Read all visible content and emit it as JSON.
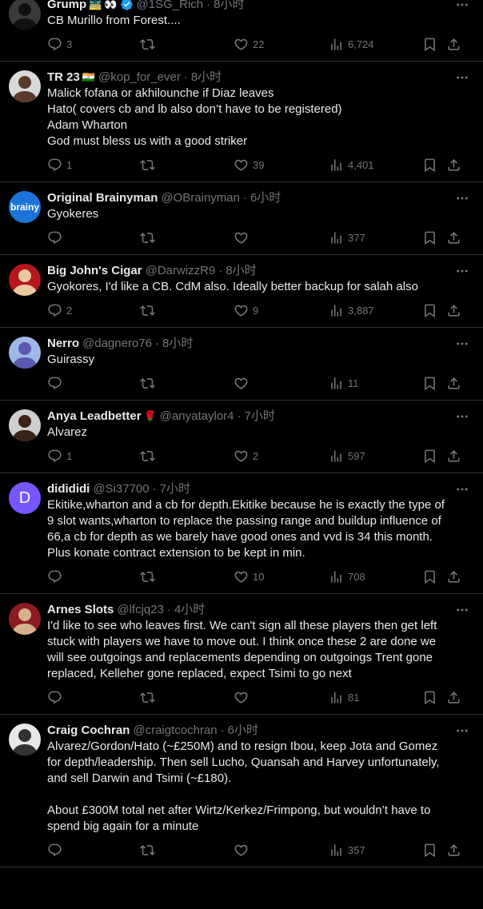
{
  "tweets": [
    {
      "name": "Grump",
      "badges": [
        "🚟",
        "👀",
        "verified"
      ],
      "handle": "@1SG_Rich",
      "time": "8小时",
      "lines": [
        "CB Murillo from Forest...."
      ],
      "replies": "3",
      "retweets": "",
      "likes": "22",
      "views": "6,724",
      "avatar": {
        "type": "photo",
        "bg": "#3a3a3a",
        "fg": "#111111"
      }
    },
    {
      "name": "TR 23",
      "badges": [
        "🇮🇳"
      ],
      "handle": "@kop_for_ever",
      "time": "8小时",
      "lines": [
        "Malick fofana or akhilounche if Diaz leaves",
        "Hato( covers cb and lb also don’t have to be registered)",
        "Adam Wharton",
        "God must bless us with a good striker"
      ],
      "replies": "1",
      "retweets": "",
      "likes": "39",
      "views": "4,401",
      "avatar": {
        "type": "photo",
        "bg": "#d9d9d9",
        "fg": "#5b3a29"
      }
    },
    {
      "name": "Original Brainyman",
      "badges": [],
      "handle": "@OBrainyman",
      "time": "6小时",
      "lines": [
        "Gyokeres"
      ],
      "replies": "",
      "retweets": "",
      "likes": "",
      "views": "377",
      "avatar": {
        "type": "logo",
        "bg": "#1d74d8",
        "text": "brainy"
      }
    },
    {
      "name": "Big John's Cigar",
      "badges": [],
      "handle": "@DarwizzR9",
      "time": "8小时",
      "lines": [
        "Gyokores, I'd like a CB. CdM also. Ideally better backup for salah also"
      ],
      "replies": "2",
      "retweets": "",
      "likes": "9",
      "views": "3,887",
      "avatar": {
        "type": "photo",
        "bg": "#b5171e",
        "fg": "#e8c9a0"
      }
    },
    {
      "name": "Nerro",
      "badges": [],
      "handle": "@dagnero76",
      "time": "8小时",
      "lines": [
        "Guirassy"
      ],
      "replies": "",
      "retweets": "",
      "likes": "",
      "views": "11",
      "avatar": {
        "type": "photo",
        "bg": "#9fb8e8",
        "fg": "#5a5ab0"
      }
    },
    {
      "name": "Anya Leadbetter",
      "badges": [
        "🌹"
      ],
      "handle": "@anyataylor4",
      "time": "7小时",
      "lines": [
        "Alvarez"
      ],
      "replies": "1",
      "retweets": "",
      "likes": "2",
      "views": "597",
      "avatar": {
        "type": "photo",
        "bg": "#cfcfcf",
        "fg": "#3b2318"
      }
    },
    {
      "name": "didididi",
      "badges": [],
      "handle": "@Si37700",
      "time": "7小时",
      "lines": [
        "Ekitike,wharton and a cb for depth.Ekitike because he is exactly the type of",
        "9 slot wants,wharton to replace the passing range and buildup influence of",
        "66,a cb for depth as we barely have good ones and vvd is 34 this month.",
        "Plus konate contract extension to be kept in min."
      ],
      "replies": "",
      "retweets": "",
      "likes": "10",
      "views": "708",
      "avatar": {
        "type": "letter",
        "bg": "#7856ff",
        "text": "D"
      }
    },
    {
      "name": "Arnes Slots",
      "badges": [],
      "handle": "@lfcjq23",
      "time": "4小时",
      "lines": [
        "I'd like to see who leaves first. We can't sign all these players then get left",
        "stuck with players we have to move out. I think once these 2 are done we",
        "will see outgoings and replacements depending on outgoings Trent gone",
        "replaced, Kelleher gone replaced, expect Tsimi to go next"
      ],
      "replies": "",
      "retweets": "",
      "likes": "",
      "views": "81",
      "avatar": {
        "type": "photo",
        "bg": "#8c1c22",
        "fg": "#d7b08d"
      }
    },
    {
      "name": "Craig Cochran",
      "badges": [],
      "handle": "@craigtcochran",
      "time": "6小时",
      "lines": [
        "Alvarez/Gordon/Hato (~£250M) and to resign Ibou, keep Jota and Gomez",
        "for depth/leadership. Then sell Lucho, Quansah and Harvey unfortunately,",
        "and sell Darwin and Tsimi (~£180).",
        "",
        "About £300M total net after Wirtz/Kerkez/Frimpong, but wouldn’t have to",
        "spend big again for a minute"
      ],
      "replies": "",
      "retweets": "",
      "likes": "",
      "views": "357",
      "avatar": {
        "type": "photo",
        "bg": "#e8e8e8",
        "fg": "#333333"
      }
    }
  ],
  "colors": {
    "background": "#000000",
    "text": "#e7e9ea",
    "muted": "#71767b",
    "divider": "#2f3336",
    "verified": "#1d9bf0"
  }
}
